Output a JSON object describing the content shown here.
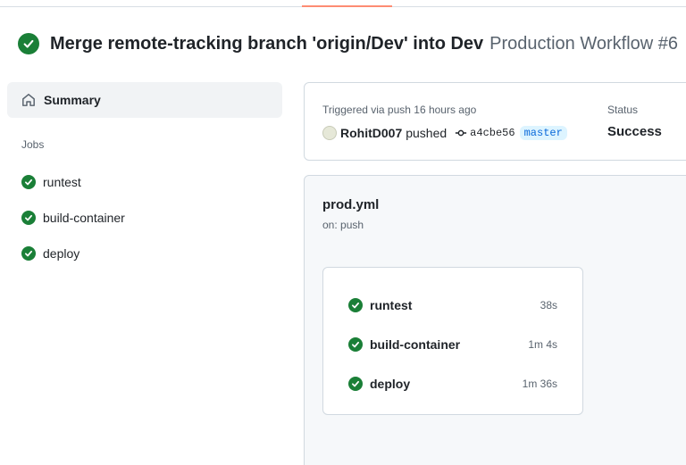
{
  "header": {
    "title": "Merge remote-tracking branch 'origin/Dev' into Dev",
    "workflow": "Production Workflow #6",
    "status_icon": "check-circle-fill-icon"
  },
  "sidebar": {
    "summary_label": "Summary",
    "jobs_heading": "Jobs",
    "jobs": [
      {
        "label": "runtest"
      },
      {
        "label": "build-container"
      },
      {
        "label": "deploy"
      }
    ]
  },
  "run_info": {
    "trigger_label": "Triggered via push 16 hours ago",
    "actor": "RohitD007",
    "action": "pushed",
    "commit_sha": "a4cbe56",
    "branch": "master",
    "status_label": "Status",
    "status_value": "Success"
  },
  "workflow_graph": {
    "file": "prod.yml",
    "event": "on: push",
    "jobs": [
      {
        "label": "runtest",
        "duration": "38s"
      },
      {
        "label": "build-container",
        "duration": "1m 4s"
      },
      {
        "label": "deploy",
        "duration": "1m 36s"
      }
    ]
  },
  "colors": {
    "success": "#1a7f37",
    "accent_underline": "#fd8c73",
    "branch_text": "#0969da",
    "branch_bg": "#ddf4ff"
  }
}
